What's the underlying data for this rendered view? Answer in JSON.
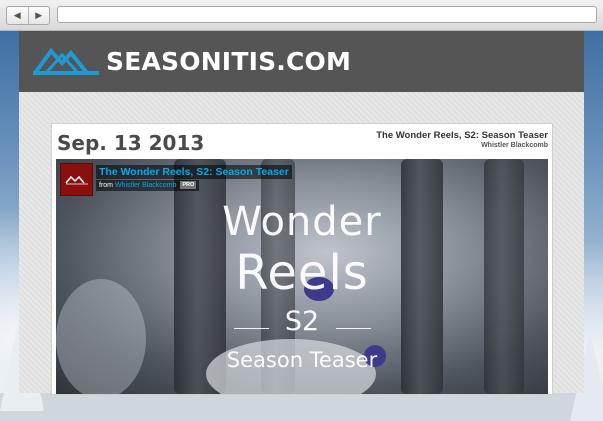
{
  "browser": {
    "back_glyph": "◀",
    "forward_glyph": "▶",
    "address_value": ""
  },
  "site": {
    "name": "SEASONITIS.COM",
    "header_color": "#555555",
    "logo_color": "#1e9ad6"
  },
  "post": {
    "date": "Sep. 13 2013",
    "title": "The Wonder Reels, S2: Season Teaser",
    "subtitle": "Whistler Blackcomb"
  },
  "video": {
    "title": "The Wonder Reels, S2: Season Teaser",
    "byline_prefix": "from",
    "byline_author": "Whistler Blackcomb",
    "badge": "PRO",
    "overlay": {
      "line1": "Wonder",
      "line2": "Reels",
      "line3": "S2",
      "line4": "Season Teaser"
    }
  }
}
